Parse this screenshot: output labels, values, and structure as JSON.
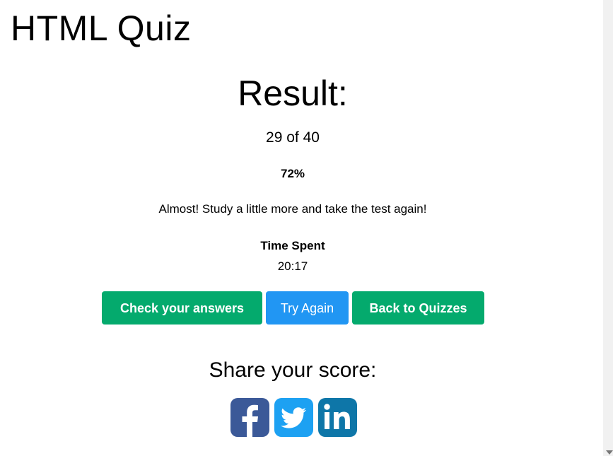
{
  "page": {
    "title": "HTML Quiz"
  },
  "result": {
    "heading": "Result:",
    "score_text": "29 of 40",
    "correct": 29,
    "total": 40,
    "percent_text": "72%",
    "message": "Almost! Study a little more and take the test again!",
    "time_spent_label": "Time Spent",
    "time_spent_value": "20:17"
  },
  "actions": {
    "check_answers_label": "Check your answers",
    "try_again_label": "Try Again",
    "back_to_quizzes_label": "Back to Quizzes"
  },
  "share": {
    "heading": "Share your score:",
    "networks": [
      {
        "name": "facebook",
        "icon": "facebook-icon"
      },
      {
        "name": "twitter",
        "icon": "twitter-icon"
      },
      {
        "name": "linkedin",
        "icon": "linkedin-icon"
      }
    ]
  },
  "colors": {
    "green_button": "#04aa6d",
    "blue_button": "#2196f3",
    "facebook": "#3b5998",
    "twitter": "#1da1f2",
    "linkedin": "#0e76a8"
  }
}
